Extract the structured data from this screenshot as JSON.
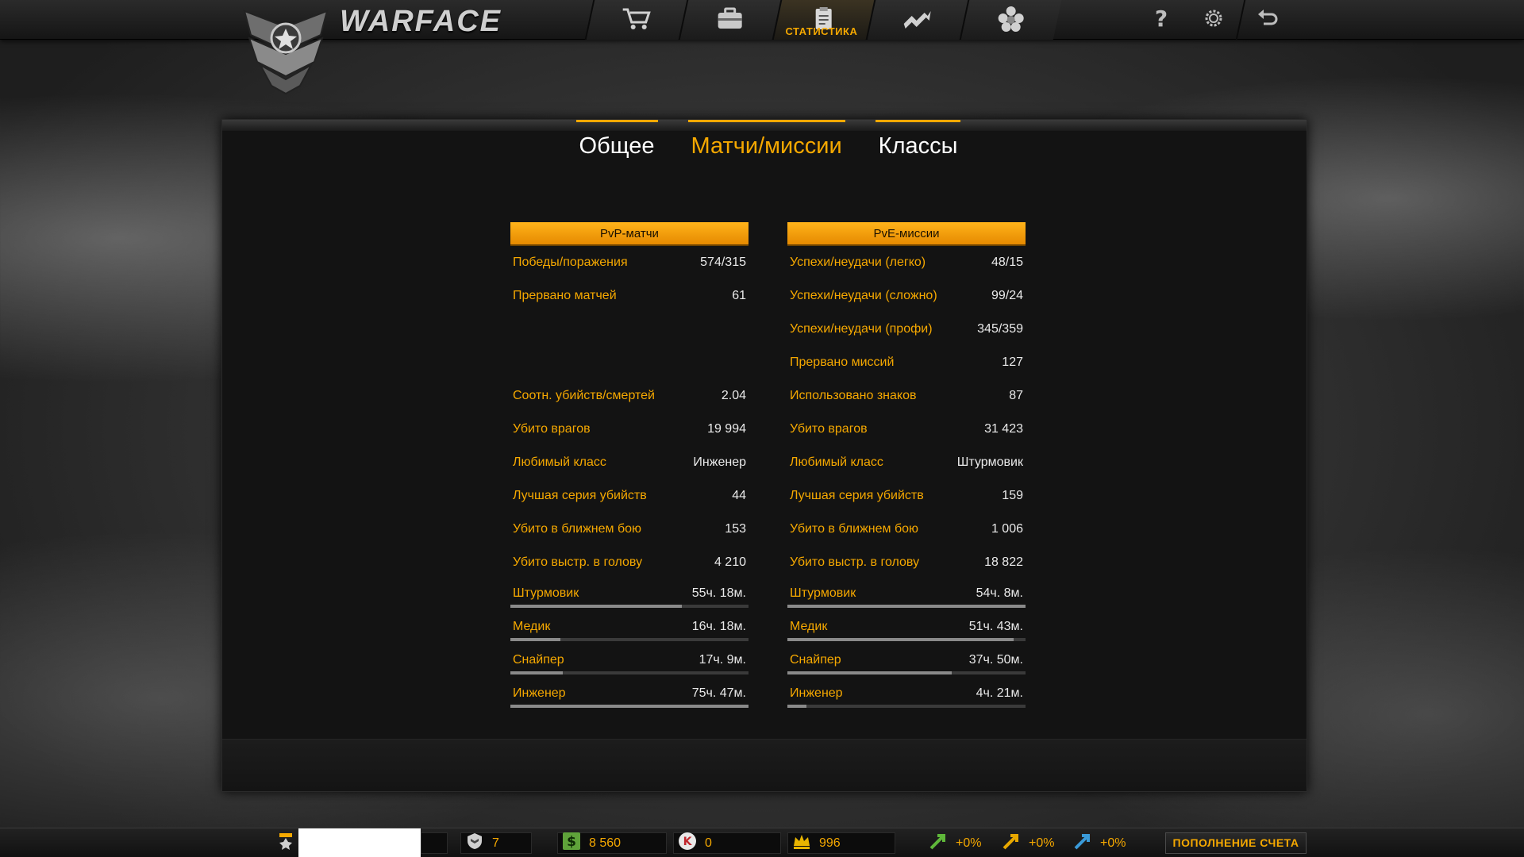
{
  "app": {
    "logo_text": "WARFACE"
  },
  "nav": {
    "items": [
      {
        "icon": "shop-cart-icon"
      },
      {
        "icon": "inventory-case-icon"
      },
      {
        "icon": "statistics-clipboard-icon",
        "label": "СТАТИСТИКА",
        "active": true
      },
      {
        "icon": "achievements-icon"
      },
      {
        "icon": "clan-icon"
      }
    ],
    "util": [
      "help-icon",
      "settings-gear-icon",
      "exit-back-icon"
    ]
  },
  "tabs": [
    {
      "label": "Общее",
      "active": false
    },
    {
      "label": "Матчи/миссии",
      "active": true
    },
    {
      "label": "Классы",
      "active": false
    }
  ],
  "pvp": {
    "header": "PvP-матчи",
    "rows": [
      {
        "label": "Победы/поражения",
        "value": "574/315"
      },
      {
        "label": "Прервано матчей",
        "value": "61"
      },
      {
        "label": "Соотн. убийств/смертей",
        "value": "2.04"
      },
      {
        "label": "Убито врагов",
        "value": "19 994"
      },
      {
        "label": "Любимый класс",
        "value": "Инженер"
      },
      {
        "label": "Лучшая серия убийств",
        "value": "44"
      },
      {
        "label": "Убито в ближнем бою",
        "value": "153"
      },
      {
        "label": "Убито выстр. в голову",
        "value": "4 210"
      }
    ],
    "classes": [
      {
        "label": "Штурмовик",
        "value": "55ч. 18м.",
        "fill": 0.72
      },
      {
        "label": "Медик",
        "value": "16ч. 18м.",
        "fill": 0.21
      },
      {
        "label": "Снайпер",
        "value": "17ч. 9м.",
        "fill": 0.22
      },
      {
        "label": "Инженер",
        "value": "75ч. 47м.",
        "fill": 1.0
      }
    ]
  },
  "pve": {
    "header": "PvE-миссии",
    "rows": [
      {
        "label": "Успехи/неудачи (легко)",
        "value": "48/15"
      },
      {
        "label": "Успехи/неудачи (сложно)",
        "value": "99/24"
      },
      {
        "label": "Успехи/неудачи (профи)",
        "value": "345/359"
      },
      {
        "label": "Прервано миссий",
        "value": "127"
      },
      {
        "label": "Использовано знаков",
        "value": "87"
      },
      {
        "label": "Убито врагов",
        "value": "31 423"
      },
      {
        "label": "Любимый класс",
        "value": "Штурмовик"
      },
      {
        "label": "Лучшая серия убийств",
        "value": "159"
      },
      {
        "label": "Убито в ближнем бою",
        "value": "1 006"
      },
      {
        "label": "Убито выстр. в голову",
        "value": "18 822"
      }
    ],
    "classes": [
      {
        "label": "Штурмовик",
        "value": "54ч. 8м.",
        "fill": 1.0
      },
      {
        "label": "Медик",
        "value": "51ч. 43м.",
        "fill": 0.95
      },
      {
        "label": "Снайпер",
        "value": "37ч. 50м.",
        "fill": 0.69
      },
      {
        "label": "Инженер",
        "value": "4ч. 21м.",
        "fill": 0.08
      }
    ]
  },
  "bottom": {
    "rank_badges": "7",
    "money": "8 560",
    "kredits": "0",
    "crowns": "996",
    "boost_xp": "+0%",
    "boost_money": "+0%",
    "boost_vp": "+0%",
    "topup_label": "ПОПОЛНЕНИЕ СЧЕТА",
    "accent": "#f5a800"
  }
}
